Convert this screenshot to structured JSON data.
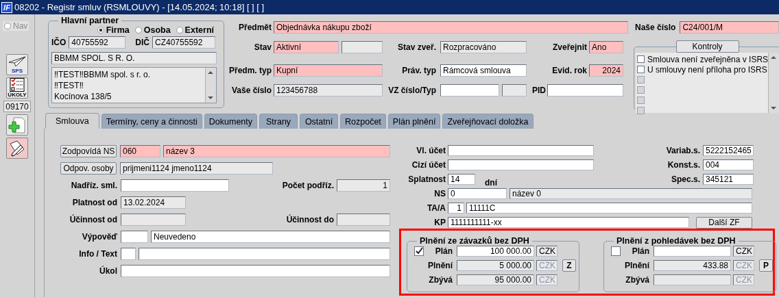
{
  "window": {
    "logo": "IF",
    "title": "08202 - Registr smluv (RSMLOUVY) - [14.05.2024; 10:18] [ ] [ ]"
  },
  "sidebar": {
    "nav": {
      "label": "Nav",
      "selected": false,
      "disabled": true
    },
    "tools": [
      {
        "kind": "plane",
        "label": "SPS"
      },
      {
        "kind": "tasks",
        "label": "ÚKOLY"
      },
      {
        "kind": "code",
        "label": "09170"
      },
      {
        "kind": "add"
      },
      {
        "kind": "edit"
      }
    ]
  },
  "partner": {
    "title": "Hlavní partner",
    "types": [
      {
        "label": "Firma",
        "selected": true
      },
      {
        "label": "Osoba",
        "selected": false
      },
      {
        "label": "Externí",
        "selected": false
      }
    ],
    "ico": {
      "label": "IČO",
      "value": "40755592",
      "kind": "readonly"
    },
    "dic": {
      "label": "DIČ",
      "value": "CZ40755592",
      "kind": "readonly"
    },
    "name": {
      "value": "BBMM SPOL. S R. O.",
      "kind": "readonly"
    },
    "address_lines": [
      "‼TEST‼BBMM spol. s r. o.",
      "‼TEST‼",
      "Kocínova 138/5"
    ]
  },
  "header": {
    "subject": {
      "label": "Předmět",
      "value": "Objednávka nákupu zboží",
      "kind": "required"
    },
    "status": {
      "label": "Stav",
      "value": "Aktivní",
      "kind": "required"
    },
    "status_extra": {
      "kind": "readonly"
    },
    "publish_status": {
      "label": "Stav zveř.",
      "value": "Rozpracováno",
      "kind": "readonly"
    },
    "publish": {
      "label": "Zveřejnit",
      "value": "Ano",
      "kind": "required"
    },
    "subject_type": {
      "label": "Předm. typ",
      "value": "Kupní",
      "kind": "required"
    },
    "legal_type": {
      "label": "Práv. typ",
      "value": "Rámcová smlouva",
      "kind": "editable"
    },
    "year": {
      "label": "Evid. rok",
      "value": "2024",
      "kind": "required"
    },
    "your_number": {
      "label": "Vaše číslo",
      "value": "123456788",
      "kind": "readonly"
    },
    "vz_number": {
      "label": "VZ číslo/Typ",
      "kind": "editable"
    },
    "vz_type": {
      "kind": "readonly"
    },
    "pid": {
      "label": "PID",
      "kind": "editable"
    },
    "our_number": {
      "label": "Naše číslo",
      "value": "C24/001/M",
      "kind": "required"
    }
  },
  "checks": {
    "button": "Kontroly",
    "items": [
      {
        "label": "Smlouva není zveřejněna v ISRS",
        "checked": false,
        "disabled": false
      },
      {
        "label": "U smlouvy není příloha pro ISRS",
        "checked": false,
        "disabled": false
      },
      {
        "checked": false,
        "disabled": true
      },
      {
        "checked": false,
        "disabled": true
      },
      {
        "checked": false,
        "disabled": true
      },
      {
        "checked": false,
        "disabled": true
      }
    ]
  },
  "tabs": [
    {
      "label": "Smlouva",
      "selected": true
    },
    {
      "label": "Termíny, ceny a činnosti",
      "selected": false
    },
    {
      "label": "Dokumenty",
      "selected": false
    },
    {
      "label": "Strany",
      "selected": false
    },
    {
      "label": "Ostatní",
      "selected": false
    },
    {
      "label": "Rozpočet",
      "selected": false
    },
    {
      "label": "Plán plnění",
      "selected": false
    },
    {
      "label": "Zveřejňovací doložka",
      "selected": false
    }
  ],
  "contract": {
    "ns_button": "Zodpovídá NS",
    "ns_code": {
      "value": "060",
      "kind": "required"
    },
    "ns_name": {
      "value": "název 3",
      "kind": "required"
    },
    "persons_button": "Odpov. osoby",
    "persons": {
      "value": "prijmeni1124 jmeno1124",
      "kind": "readonly"
    },
    "parent": {
      "label": "Nadříz. sml.",
      "kind": "editable"
    },
    "child_count": {
      "label": "Počet podříz.",
      "value": "1",
      "kind": "readonly"
    },
    "valid_from": {
      "label": "Platnost od",
      "value": "13.02.2024",
      "kind": "readonly"
    },
    "effective_from": {
      "label": "Účinnost od",
      "kind": "readonly"
    },
    "effective_to": {
      "label": "Účinnost do",
      "kind": "readonly"
    },
    "notice": {
      "label": "Výpověď",
      "kind": "editable"
    },
    "notice_text": {
      "value": "Neuvedeno",
      "kind": "editable"
    },
    "info": {
      "label": "Info / Text",
      "kind": "editable"
    },
    "info_text": {
      "kind": "editable"
    },
    "task": {
      "label": "Úkol",
      "kind": "editable"
    },
    "own_account": {
      "label": "Vl. účet",
      "kind": "editable"
    },
    "variable_symbol": {
      "label": "Variab.s.",
      "value": "5222152465",
      "kind": "editable"
    },
    "foreign_account": {
      "label": "Cizí účet",
      "kind": "editable"
    },
    "constant_symbol": {
      "label": "Konst.s.",
      "value": "004",
      "kind": "editable"
    },
    "due": {
      "label": "Splatnost",
      "value": "14",
      "kind": "editable",
      "unit": "dní"
    },
    "specific_symbol": {
      "label": "Spec.s.",
      "value": "345121",
      "kind": "editable"
    },
    "ns": {
      "label": "NS",
      "value": "0",
      "kind": "editable"
    },
    "ns_desc": {
      "value": "název 0",
      "kind": "readonly"
    },
    "ta": {
      "label": "TA/A",
      "value": "1",
      "kind": "editable"
    },
    "ta_code": {
      "value": "11111C",
      "kind": "editable"
    },
    "kp": {
      "label": "KP",
      "value": "1111111111-xx",
      "kind": "editable"
    },
    "next_button": "Další ZF",
    "fulfilment": [
      {
        "title": "Plnění ze závazků bez DPH",
        "checked": true,
        "button": "Z",
        "rows": [
          {
            "label": "Plán",
            "value": "100 000.00",
            "kind": "editable",
            "currency": {
              "value": "CZK",
              "kind": "readonly"
            }
          },
          {
            "label": "Plnění",
            "value": "5 000.00",
            "kind": "readonly",
            "currency": {
              "value": "CZK",
              "kind": "disabled"
            }
          },
          {
            "label": "Zbývá",
            "value": "95 000.00",
            "kind": "readonly",
            "currency": {
              "value": "CZK",
              "kind": "disabled"
            }
          }
        ]
      },
      {
        "title": "Plnění z pohledávek bez DPH",
        "checked": false,
        "button": "P",
        "rows": [
          {
            "label": "Plán",
            "kind": "editable",
            "currency": {
              "value": "CZK",
              "kind": "readonly"
            }
          },
          {
            "label": "Plnění",
            "value": "433.88",
            "kind": "readonly",
            "currency": {
              "value": "CZK",
              "kind": "disabled"
            }
          },
          {
            "label": "Zbývá",
            "kind": "readonly",
            "currency": {
              "value": "CZK",
              "kind": "disabled"
            }
          }
        ]
      }
    ]
  }
}
